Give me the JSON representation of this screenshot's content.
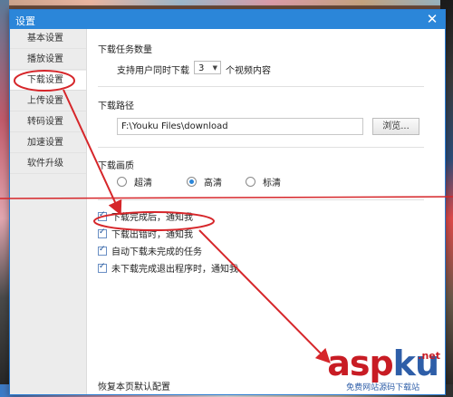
{
  "window": {
    "title": "设置",
    "close_label": "✕"
  },
  "sidebar": {
    "items": [
      {
        "label": "基本设置",
        "active": false
      },
      {
        "label": "播放设置",
        "active": false
      },
      {
        "label": "下载设置",
        "active": true
      },
      {
        "label": "上传设置",
        "active": false
      },
      {
        "label": "转码设置",
        "active": false
      },
      {
        "label": "加速设置",
        "active": false
      },
      {
        "label": "软件升级",
        "active": false
      }
    ]
  },
  "download_tasks": {
    "title": "下载任务数量",
    "prefix": "支持用户同时下载",
    "value": "3",
    "suffix": "个视频内容"
  },
  "download_path": {
    "title": "下载路径",
    "value": "F:\\Youku Files\\download",
    "browse_label": "浏览..."
  },
  "quality": {
    "title": "下载画质",
    "options": [
      {
        "label": "超清",
        "selected": false
      },
      {
        "label": "高清",
        "selected": true
      },
      {
        "label": "标清",
        "selected": false
      }
    ]
  },
  "notifications": [
    {
      "label": "下载完成后，通知我",
      "checked": true
    },
    {
      "label": "下载出错时，通知我",
      "checked": true
    },
    {
      "label": "自动下载未完成的任务",
      "checked": true
    },
    {
      "label": "未下载完成退出程序时，通知我",
      "checked": true
    }
  ],
  "footer": {
    "restore_label": "恢复本页默认配置"
  },
  "watermark": {
    "main_a": "asp",
    "main_b": "ku",
    "net": ".net",
    "sub": "免费网站源码下载站"
  },
  "colors": {
    "annotation": "#d6262a",
    "accent": "#2b86d9"
  }
}
